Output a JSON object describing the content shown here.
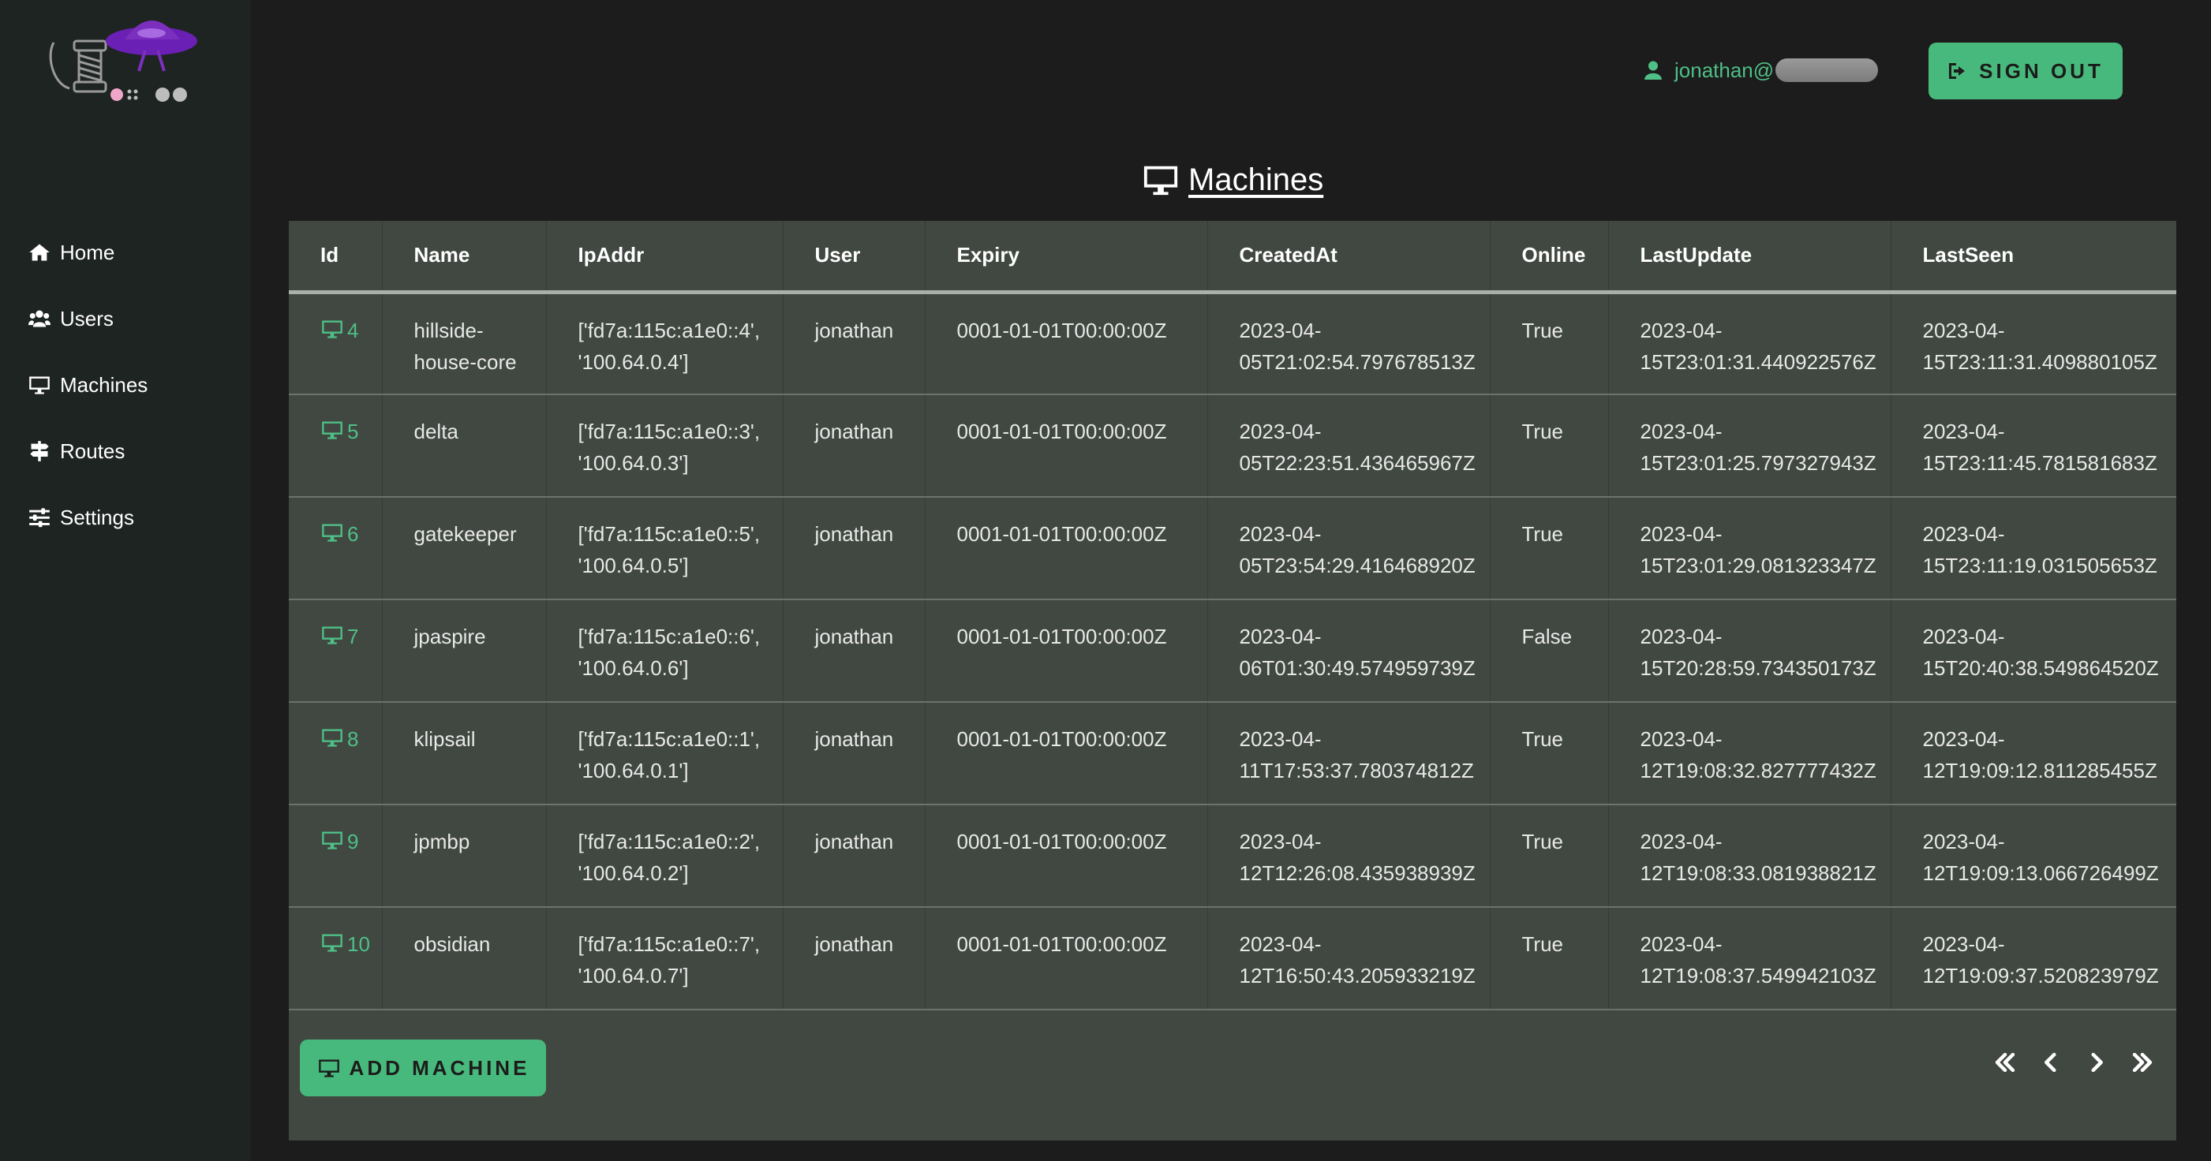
{
  "user": {
    "email_prefix": "jonathan@"
  },
  "header": {
    "signout_label": "SIGN OUT"
  },
  "nav": {
    "items": [
      {
        "label": "Home",
        "icon": "home-icon"
      },
      {
        "label": "Users",
        "icon": "users-icon"
      },
      {
        "label": "Machines",
        "icon": "monitor-icon"
      },
      {
        "label": "Routes",
        "icon": "signpost-icon"
      },
      {
        "label": "Settings",
        "icon": "sliders-icon"
      }
    ]
  },
  "page": {
    "title": "Machines"
  },
  "table": {
    "columns": [
      "Id",
      "Name",
      "IpAddr",
      "User",
      "Expiry",
      "CreatedAt",
      "Online",
      "LastUpdate",
      "LastSeen"
    ],
    "rows": [
      [
        "4",
        "hillside-\nhouse-core",
        "['fd7a:115c:a1e0::4',\n'100.64.0.4']",
        "jonathan",
        "0001-01-01T00:00:00Z",
        "2023-04-\n05T21:02:54.797678513Z",
        "True",
        "2023-04-\n15T23:01:31.440922576Z",
        "2023-04-\n15T23:11:31.409880105Z"
      ],
      [
        "5",
        "delta",
        "['fd7a:115c:a1e0::3',\n'100.64.0.3']",
        "jonathan",
        "0001-01-01T00:00:00Z",
        "2023-04-\n05T22:23:51.436465967Z",
        "True",
        "2023-04-\n15T23:01:25.797327943Z",
        "2023-04-\n15T23:11:45.781581683Z"
      ],
      [
        "6",
        "gatekeeper",
        "['fd7a:115c:a1e0::5',\n'100.64.0.5']",
        "jonathan",
        "0001-01-01T00:00:00Z",
        "2023-04-\n05T23:54:29.416468920Z",
        "True",
        "2023-04-\n15T23:01:29.081323347Z",
        "2023-04-\n15T23:11:19.031505653Z"
      ],
      [
        "7",
        "jpaspire",
        "['fd7a:115c:a1e0::6',\n'100.64.0.6']",
        "jonathan",
        "0001-01-01T00:00:00Z",
        "2023-04-\n06T01:30:49.574959739Z",
        "False",
        "2023-04-\n15T20:28:59.734350173Z",
        "2023-04-\n15T20:40:38.549864520Z"
      ],
      [
        "8",
        "klipsail",
        "['fd7a:115c:a1e0::1',\n'100.64.0.1']",
        "jonathan",
        "0001-01-01T00:00:00Z",
        "2023-04-\n11T17:53:37.780374812Z",
        "True",
        "2023-04-\n12T19:08:32.827777432Z",
        "2023-04-\n12T19:09:12.811285455Z"
      ],
      [
        "9",
        "jpmbp",
        "['fd7a:115c:a1e0::2',\n'100.64.0.2']",
        "jonathan",
        "0001-01-01T00:00:00Z",
        "2023-04-\n12T12:26:08.435938939Z",
        "True",
        "2023-04-\n12T19:08:33.081938821Z",
        "2023-04-\n12T19:09:13.066726499Z"
      ],
      [
        "10",
        "obsidian",
        "['fd7a:115c:a1e0::7',\n'100.64.0.7']",
        "jonathan",
        "0001-01-01T00:00:00Z",
        "2023-04-\n12T16:50:43.205933219Z",
        "True",
        "2023-04-\n12T19:08:37.549942103Z",
        "2023-04-\n12T19:09:37.520823979Z"
      ]
    ]
  },
  "footer": {
    "add_machine_label": "ADD MACHINE",
    "pager": [
      "first-page-icon",
      "prev-page-icon",
      "next-page-icon",
      "last-page-icon"
    ]
  },
  "colors": {
    "accent": "#48b97c",
    "panel": "#404841",
    "sidebar": "#1e2421",
    "background": "#1b1c1b",
    "logo_purple": "#7b2fbe"
  }
}
